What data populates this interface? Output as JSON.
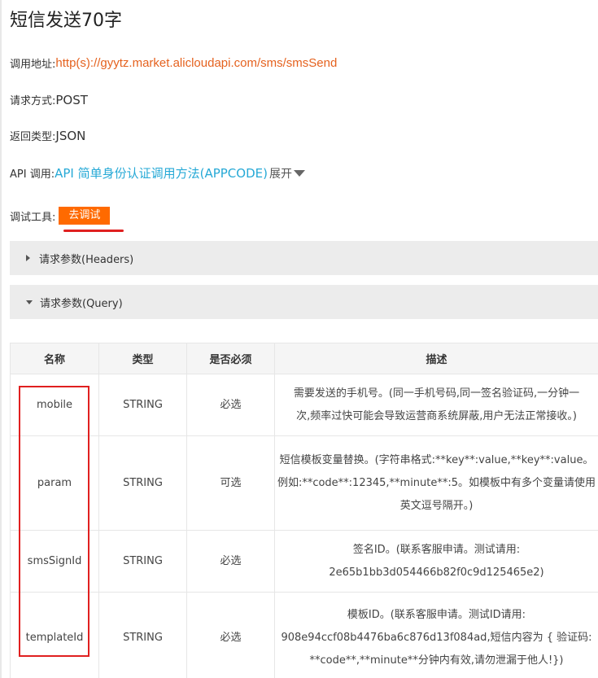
{
  "page": {
    "title": "短信发送70字"
  },
  "info": {
    "url_label": "调用地址:",
    "url_value": "http(s)://gyytz.market.alicloudapi.com/sms/smsSend",
    "method_label": "请求方式:",
    "method_value": "POST",
    "return_label": "返回类型:",
    "return_value": "JSON",
    "api_label": "API 调用:",
    "api_link": "API 简单身份认证调用方法(APPCODE)",
    "expand_label": "展开",
    "debug_label": "调试工具:",
    "debug_button": "去调试"
  },
  "panels": {
    "headers_label": "请求参数(Headers)",
    "query_label": "请求参数(Query)"
  },
  "table": {
    "headers": [
      "名称",
      "类型",
      "是否必须",
      "描述"
    ],
    "rows": [
      {
        "name": "mobile",
        "type": "STRING",
        "required": "必选",
        "desc_lines": [
          "需要发送的手机号。(同一手机号码,同一签名验证码,一分钟一",
          "次,频率过快可能会导致运营商系统屏蔽,用户无法正常接收。)"
        ]
      },
      {
        "name": "param",
        "type": "STRING",
        "required": "可选",
        "desc_lines": [
          "短信模板变量替换。(字符串格式:**key**:value,**key**:value。",
          "例如:**code**:12345,**minute**:5。如模板中有多个变量请使用",
          "英文逗号隔开。)"
        ]
      },
      {
        "name": "smsSignId",
        "type": "STRING",
        "required": "必选",
        "desc_lines": [
          "签名ID。(联系客服申请。测试请用:",
          "2e65b1bb3d054466b82f0c9d125465e2)"
        ]
      },
      {
        "name": "templateId",
        "type": "STRING",
        "required": "必选",
        "desc_lines": [
          "模板ID。(联系客服申请。测试ID请用:",
          "908e94ccf08b4476ba6c876d13f084ad,短信内容为 { 验证码:",
          "**code**,**minute**分钟内有效,请勿泄漏于他人!})"
        ]
      }
    ]
  },
  "colors": {
    "accent_orange": "#ff6a00",
    "url_orange": "#e5621f",
    "link_blue": "#26a9d6",
    "highlight_red": "#e02020"
  }
}
